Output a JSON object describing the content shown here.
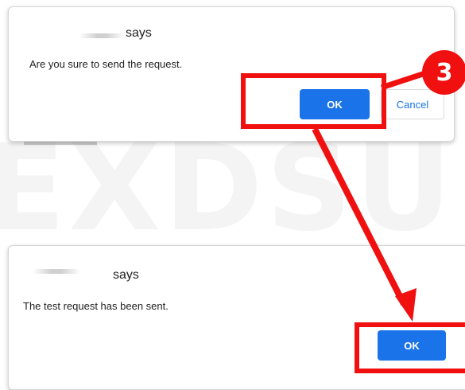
{
  "watermark": "EXDSU",
  "step_badge": "3",
  "dialog_confirm": {
    "says": "says",
    "message": "Are you sure to send the request.",
    "ok_label": "OK",
    "cancel_label": "Cancel"
  },
  "dialog_sent": {
    "says": "says",
    "message": "The test request has been sent.",
    "ok_label": "OK"
  },
  "colors": {
    "annotation_red": "#f01010",
    "button_blue": "#1a73e8"
  }
}
